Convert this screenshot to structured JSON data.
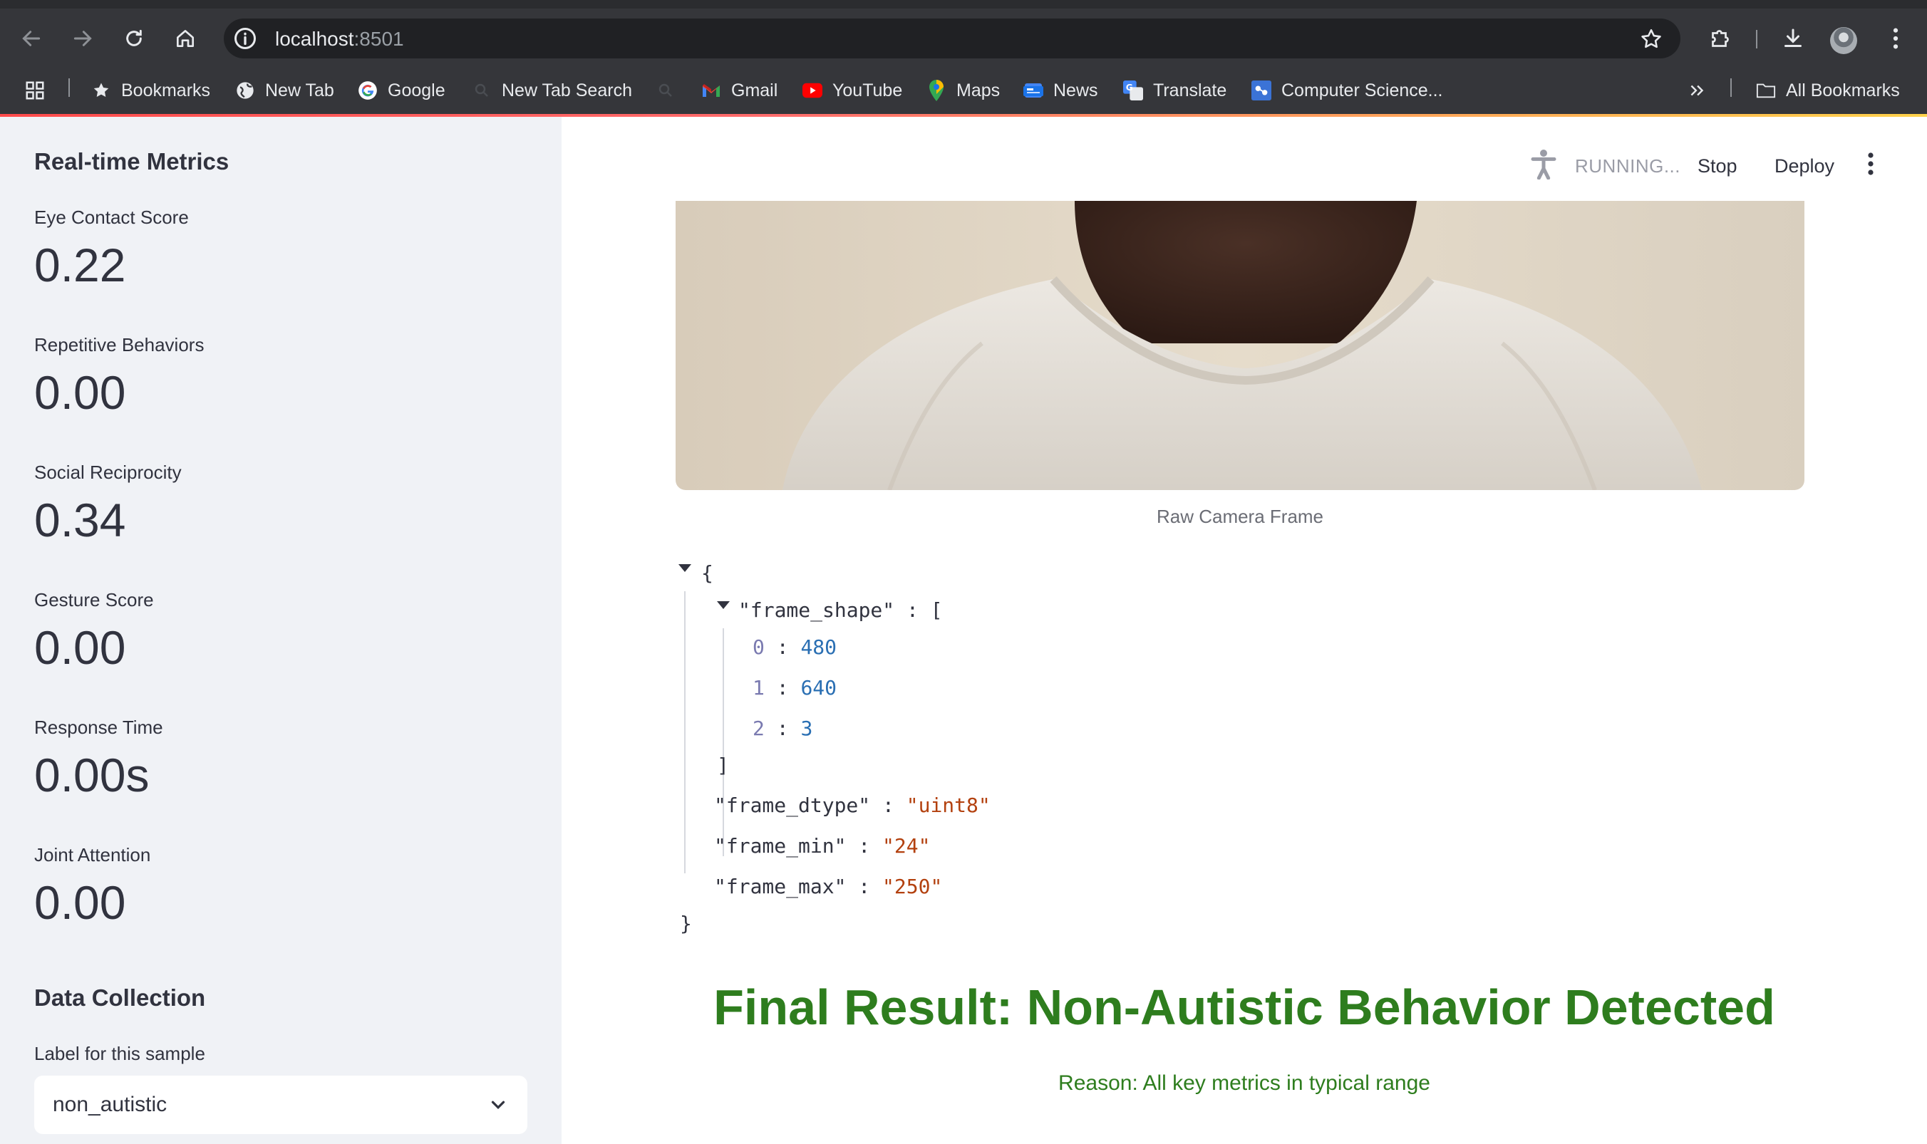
{
  "browser": {
    "url_host": "localhost",
    "url_port": ":8501",
    "bookmarks": [
      {
        "label": "Bookmarks",
        "icon": "star-icon"
      },
      {
        "label": "New Tab",
        "icon": "globe-icon"
      },
      {
        "label": "Google",
        "icon": "google-icon"
      },
      {
        "label": "New Tab Search",
        "icon": "search-icon"
      },
      {
        "label": "",
        "icon": "search-icon"
      },
      {
        "label": "Gmail",
        "icon": "gmail-icon"
      },
      {
        "label": "YouTube",
        "icon": "youtube-icon"
      },
      {
        "label": "Maps",
        "icon": "maps-icon"
      },
      {
        "label": "News",
        "icon": "news-icon"
      },
      {
        "label": "Translate",
        "icon": "translate-icon"
      },
      {
        "label": "Computer Science...",
        "icon": "site-icon"
      }
    ],
    "all_bookmarks": "All Bookmarks"
  },
  "sidebar": {
    "title": "Real-time Metrics",
    "metrics": [
      {
        "label": "Eye Contact Score",
        "value": "0.22"
      },
      {
        "label": "Repetitive Behaviors",
        "value": "0.00"
      },
      {
        "label": "Social Reciprocity",
        "value": "0.34"
      },
      {
        "label": "Gesture Score",
        "value": "0.00"
      },
      {
        "label": "Response Time",
        "value": "0.00s"
      },
      {
        "label": "Joint Attention",
        "value": "0.00"
      }
    ],
    "data_collection": {
      "title": "Data Collection",
      "select_label": "Label for this sample",
      "select_value": "non_autistic"
    }
  },
  "header": {
    "status": "RUNNING...",
    "stop": "Stop",
    "deploy": "Deploy"
  },
  "main": {
    "image_caption": "Raw Camera Frame",
    "json": {
      "open_brace": "{",
      "close_brace": "}",
      "shape_key": "\"frame_shape\"",
      "shape_open": "[",
      "shape_close": "]",
      "shape": [
        {
          "index": "0",
          "value": "480"
        },
        {
          "index": "1",
          "value": "640"
        },
        {
          "index": "2",
          "value": "3"
        }
      ],
      "dtype_key": "\"frame_dtype\"",
      "dtype_val": "\"uint8\"",
      "min_key": "\"frame_min\"",
      "min_val": "\"24\"",
      "max_key": "\"frame_max\"",
      "max_val": "\"250\""
    },
    "result_title": "Final Result: Non-Autistic Behavior Detected",
    "result_reason": "Reason: All key metrics in typical range"
  }
}
